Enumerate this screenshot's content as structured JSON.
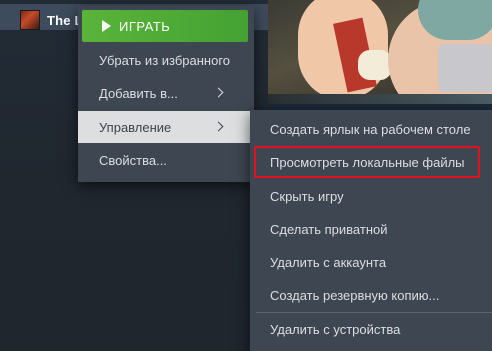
{
  "library": {
    "game_title": "The L"
  },
  "context_menu": {
    "play_label": "ИГРАТЬ",
    "items": [
      {
        "label": "Убрать из избранного"
      },
      {
        "label": "Добавить в..."
      },
      {
        "label": "Управление"
      },
      {
        "label": "Свойства..."
      }
    ]
  },
  "submenu": {
    "items": [
      {
        "label": "Создать ярлык на рабочем столе"
      },
      {
        "label": "Просмотреть локальные файлы"
      },
      {
        "label": "Скрыть игру"
      },
      {
        "label": "Сделать приватной"
      },
      {
        "label": "Удалить с аккаунта"
      },
      {
        "label": "Создать резервную копию..."
      },
      {
        "label": "Удалить с устройства"
      }
    ]
  },
  "colors": {
    "play_green": "#5ab43a",
    "highlight_red": "#e4111c",
    "menu_bg": "#3e4652"
  }
}
